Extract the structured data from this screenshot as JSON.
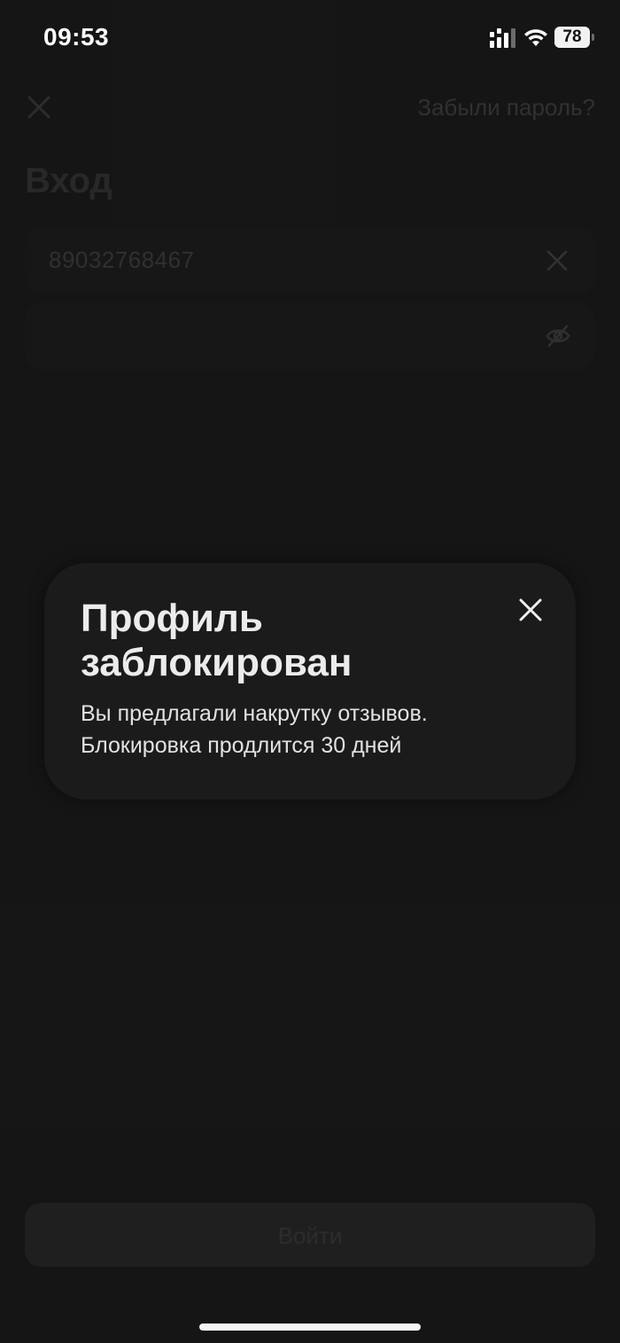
{
  "status_bar": {
    "time": "09:53",
    "battery": "78"
  },
  "login": {
    "forgot_password": "Забыли пароль?",
    "title": "Вход",
    "phone_value": "89032768467",
    "password_value": "",
    "submit_label": "Войти"
  },
  "modal": {
    "title": "Профиль заблокирован",
    "message_line1": "Вы предлагали накрутку отзывов.",
    "message_line2": "Блокировка продлится 30 дней"
  },
  "icons": {
    "close": "close-icon",
    "clear": "clear-icon",
    "eye": "eye-off-icon",
    "signal": "signal-icon",
    "wifi": "wifi-icon",
    "battery": "battery-icon"
  }
}
